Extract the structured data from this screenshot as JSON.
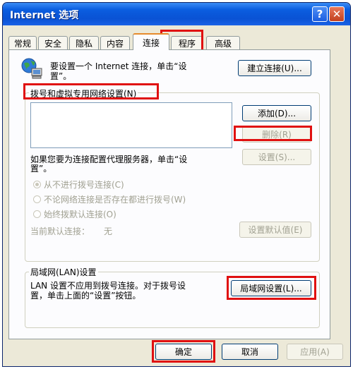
{
  "window": {
    "title": "Internet 选项",
    "help_label": "?",
    "close_label": "✕"
  },
  "tabs": [
    {
      "label": "常规"
    },
    {
      "label": "安全"
    },
    {
      "label": "隐私"
    },
    {
      "label": "内容"
    },
    {
      "label": "连接"
    },
    {
      "label": "程序"
    },
    {
      "label": "高级"
    }
  ],
  "connect": {
    "line1": "要设置一个 Internet 连接，单击“设",
    "line2": "置”。",
    "setup_button": "建立连接(U)..."
  },
  "dialup": {
    "legend": "拨号和虚拟专用网络设置(N)",
    "add_button": "添加(D)...",
    "remove_button": "删除(R)",
    "proxy_line1": "如果您要为连接配置代理服务器，单击“设",
    "proxy_line2": "置”。",
    "settings_button": "设置(S)...",
    "options": [
      {
        "label": "从不进行拨号连接(C)",
        "checked": true
      },
      {
        "label": "不论网络连接是否存在都进行拨号(W)",
        "checked": false
      },
      {
        "label": "始终拨默认连接(O)",
        "checked": false
      }
    ],
    "default_label": "当前默认连接：",
    "default_value": "无",
    "set_default_button": "设置默认值(E)"
  },
  "lan": {
    "legend": "局域网(LAN)设置",
    "line1": "LAN 设置不应用到拨号连接。对于拨号设",
    "line2": "置，单击上面的“设置”按钮。",
    "button": "局域网设置(L)..."
  },
  "footer": {
    "ok": "确定",
    "cancel": "取消",
    "apply": "应用(A)"
  },
  "colors": {
    "highlight": "#e01010",
    "title_bar": "#0a52d4",
    "active_tab_accent": "#e68b2c"
  }
}
